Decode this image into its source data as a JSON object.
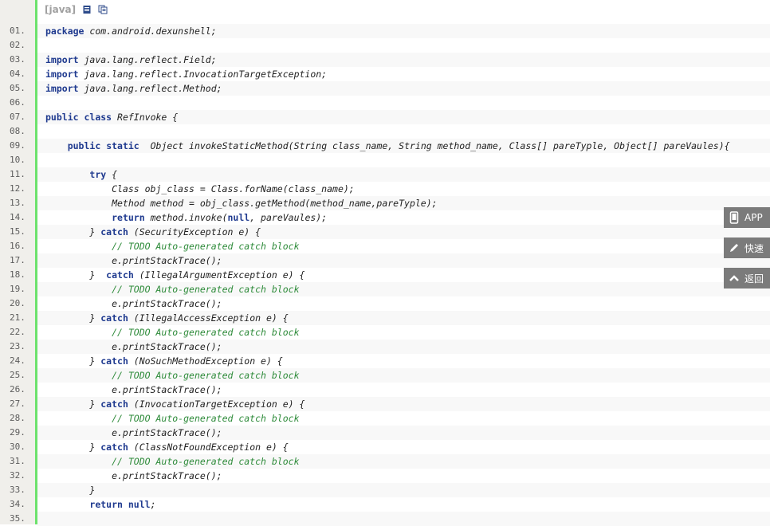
{
  "toolbar": {
    "lang_label": "[java]"
  },
  "lines": [
    {
      "n": "01.",
      "segs": [
        {
          "k": "package"
        },
        {
          "t": " com.android.dexunshell;"
        }
      ]
    },
    {
      "n": "02.",
      "segs": []
    },
    {
      "n": "03.",
      "segs": [
        {
          "k": "import"
        },
        {
          "t": " java.lang.reflect.Field;"
        }
      ]
    },
    {
      "n": "04.",
      "segs": [
        {
          "k": "import"
        },
        {
          "t": " java.lang.reflect.InvocationTargetException;"
        }
      ]
    },
    {
      "n": "05.",
      "segs": [
        {
          "k": "import"
        },
        {
          "t": " java.lang.reflect.Method;"
        }
      ]
    },
    {
      "n": "06.",
      "segs": []
    },
    {
      "n": "07.",
      "segs": [
        {
          "k": "public"
        },
        {
          "t": " "
        },
        {
          "k": "class"
        },
        {
          "t": " RefInvoke {"
        }
      ]
    },
    {
      "n": "08.",
      "segs": []
    },
    {
      "n": "09.",
      "segs": [
        {
          "t": "    "
        },
        {
          "k": "public"
        },
        {
          "t": " "
        },
        {
          "k": "static"
        },
        {
          "t": "  Object invokeStaticMethod(String class_name, String method_name, Class[] pareTyple, Object[] pareVaules){"
        }
      ]
    },
    {
      "n": "10.",
      "segs": []
    },
    {
      "n": "11.",
      "segs": [
        {
          "t": "        "
        },
        {
          "k": "try"
        },
        {
          "t": " {"
        }
      ]
    },
    {
      "n": "12.",
      "segs": [
        {
          "t": "            Class obj_class = Class.forName(class_name);"
        }
      ]
    },
    {
      "n": "13.",
      "segs": [
        {
          "t": "            Method method = obj_class.getMethod(method_name,pareTyple);"
        }
      ]
    },
    {
      "n": "14.",
      "segs": [
        {
          "t": "            "
        },
        {
          "k": "return"
        },
        {
          "t": " method.invoke("
        },
        {
          "k": "null"
        },
        {
          "t": ", pareVaules);"
        }
      ]
    },
    {
      "n": "15.",
      "segs": [
        {
          "t": "        } "
        },
        {
          "k": "catch"
        },
        {
          "t": " (SecurityException e) {"
        }
      ]
    },
    {
      "n": "16.",
      "segs": [
        {
          "t": "            "
        },
        {
          "c": "// TODO Auto-generated catch block"
        }
      ]
    },
    {
      "n": "17.",
      "segs": [
        {
          "t": "            e.printStackTrace();"
        }
      ]
    },
    {
      "n": "18.",
      "segs": [
        {
          "t": "        }  "
        },
        {
          "k": "catch"
        },
        {
          "t": " (IllegalArgumentException e) {"
        }
      ]
    },
    {
      "n": "19.",
      "segs": [
        {
          "t": "            "
        },
        {
          "c": "// TODO Auto-generated catch block"
        }
      ]
    },
    {
      "n": "20.",
      "segs": [
        {
          "t": "            e.printStackTrace();"
        }
      ]
    },
    {
      "n": "21.",
      "segs": [
        {
          "t": "        } "
        },
        {
          "k": "catch"
        },
        {
          "t": " (IllegalAccessException e) {"
        }
      ]
    },
    {
      "n": "22.",
      "segs": [
        {
          "t": "            "
        },
        {
          "c": "// TODO Auto-generated catch block"
        }
      ]
    },
    {
      "n": "23.",
      "segs": [
        {
          "t": "            e.printStackTrace();"
        }
      ]
    },
    {
      "n": "24.",
      "segs": [
        {
          "t": "        } "
        },
        {
          "k": "catch"
        },
        {
          "t": " (NoSuchMethodException e) {"
        }
      ]
    },
    {
      "n": "25.",
      "segs": [
        {
          "t": "            "
        },
        {
          "c": "// TODO Auto-generated catch block"
        }
      ]
    },
    {
      "n": "26.",
      "segs": [
        {
          "t": "            e.printStackTrace();"
        }
      ]
    },
    {
      "n": "27.",
      "segs": [
        {
          "t": "        } "
        },
        {
          "k": "catch"
        },
        {
          "t": " (InvocationTargetException e) {"
        }
      ]
    },
    {
      "n": "28.",
      "segs": [
        {
          "t": "            "
        },
        {
          "c": "// TODO Auto-generated catch block"
        }
      ]
    },
    {
      "n": "29.",
      "segs": [
        {
          "t": "            e.printStackTrace();"
        }
      ]
    },
    {
      "n": "30.",
      "segs": [
        {
          "t": "        } "
        },
        {
          "k": "catch"
        },
        {
          "t": " (ClassNotFoundException e) {"
        }
      ]
    },
    {
      "n": "31.",
      "segs": [
        {
          "t": "            "
        },
        {
          "c": "// TODO Auto-generated catch block"
        }
      ]
    },
    {
      "n": "32.",
      "segs": [
        {
          "t": "            e.printStackTrace();"
        }
      ]
    },
    {
      "n": "33.",
      "segs": [
        {
          "t": "        }"
        }
      ]
    },
    {
      "n": "34.",
      "segs": [
        {
          "t": "        "
        },
        {
          "k": "return"
        },
        {
          "t": " "
        },
        {
          "k": "null"
        },
        {
          "t": ";"
        }
      ]
    },
    {
      "n": "35.",
      "segs": []
    }
  ],
  "side_buttons": [
    {
      "icon": "phone-icon",
      "label": "APP"
    },
    {
      "icon": "pencil-icon",
      "label": "快速"
    },
    {
      "icon": "chevron-up-icon",
      "label": "返回"
    }
  ],
  "colors": {
    "keyword": "#1f3a8f",
    "comment": "#2e8b3a",
    "gutter": "#f0efeb",
    "accent_bar": "#6ce26c"
  }
}
